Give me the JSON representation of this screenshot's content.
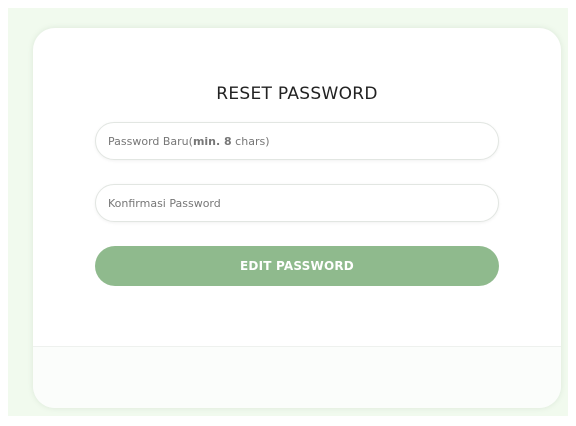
{
  "form": {
    "title": "RESET PASSWORD",
    "new_password": {
      "placeholder_prefix": "Password Baru(",
      "placeholder_bold": "min. 8",
      "placeholder_suffix": " chars)"
    },
    "confirm_password": {
      "placeholder": "Konfirmasi Password"
    },
    "submit_label": "EDIT PASSWORD"
  },
  "colors": {
    "page_background": "#f1faee",
    "card_background": "#ffffff",
    "button_background": "#8fba8d",
    "button_text": "#ffffff"
  }
}
